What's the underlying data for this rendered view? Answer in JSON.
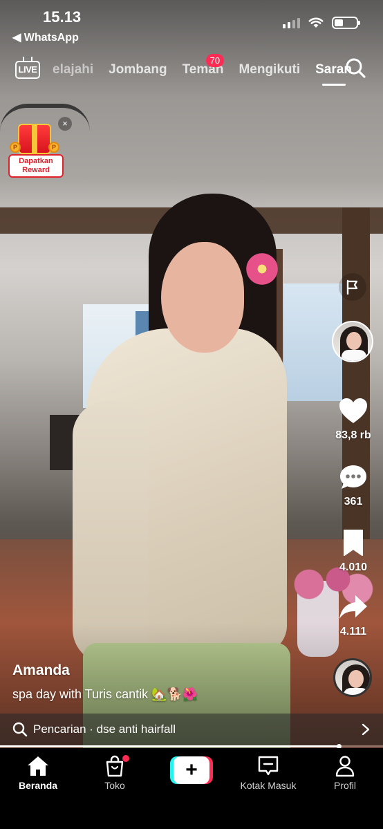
{
  "status_bar": {
    "time": "15.13",
    "back_app": "◀ WhatsApp"
  },
  "top_nav": {
    "live_label": "LIVE",
    "tabs": [
      {
        "label": "elajahi"
      },
      {
        "label": "Jombang"
      },
      {
        "label": "Teman",
        "badge": "70"
      },
      {
        "label": "Mengikuti"
      },
      {
        "label": "Saran",
        "active": true
      }
    ]
  },
  "reward": {
    "label_line1": "Dapatkan",
    "label_line2": "Reward",
    "close": "×"
  },
  "actions": {
    "likes": "83,8 rb",
    "comments": "361",
    "saves": "4.010",
    "shares": "4.111"
  },
  "post": {
    "username": "Amanda",
    "caption": "spa day with Turis cantik 🏡🐕🌺"
  },
  "search_bar": {
    "text": "Pencarian · dse anti hairfall"
  },
  "progress": {
    "value": 0.885
  },
  "bottom_tabs": {
    "home": "Beranda",
    "shop": "Toko",
    "inbox": "Kotak Masuk",
    "profile": "Profil",
    "create": "+"
  },
  "colors": {
    "accent_red": "#fe2c55",
    "accent_cyan": "#25f4ee"
  }
}
